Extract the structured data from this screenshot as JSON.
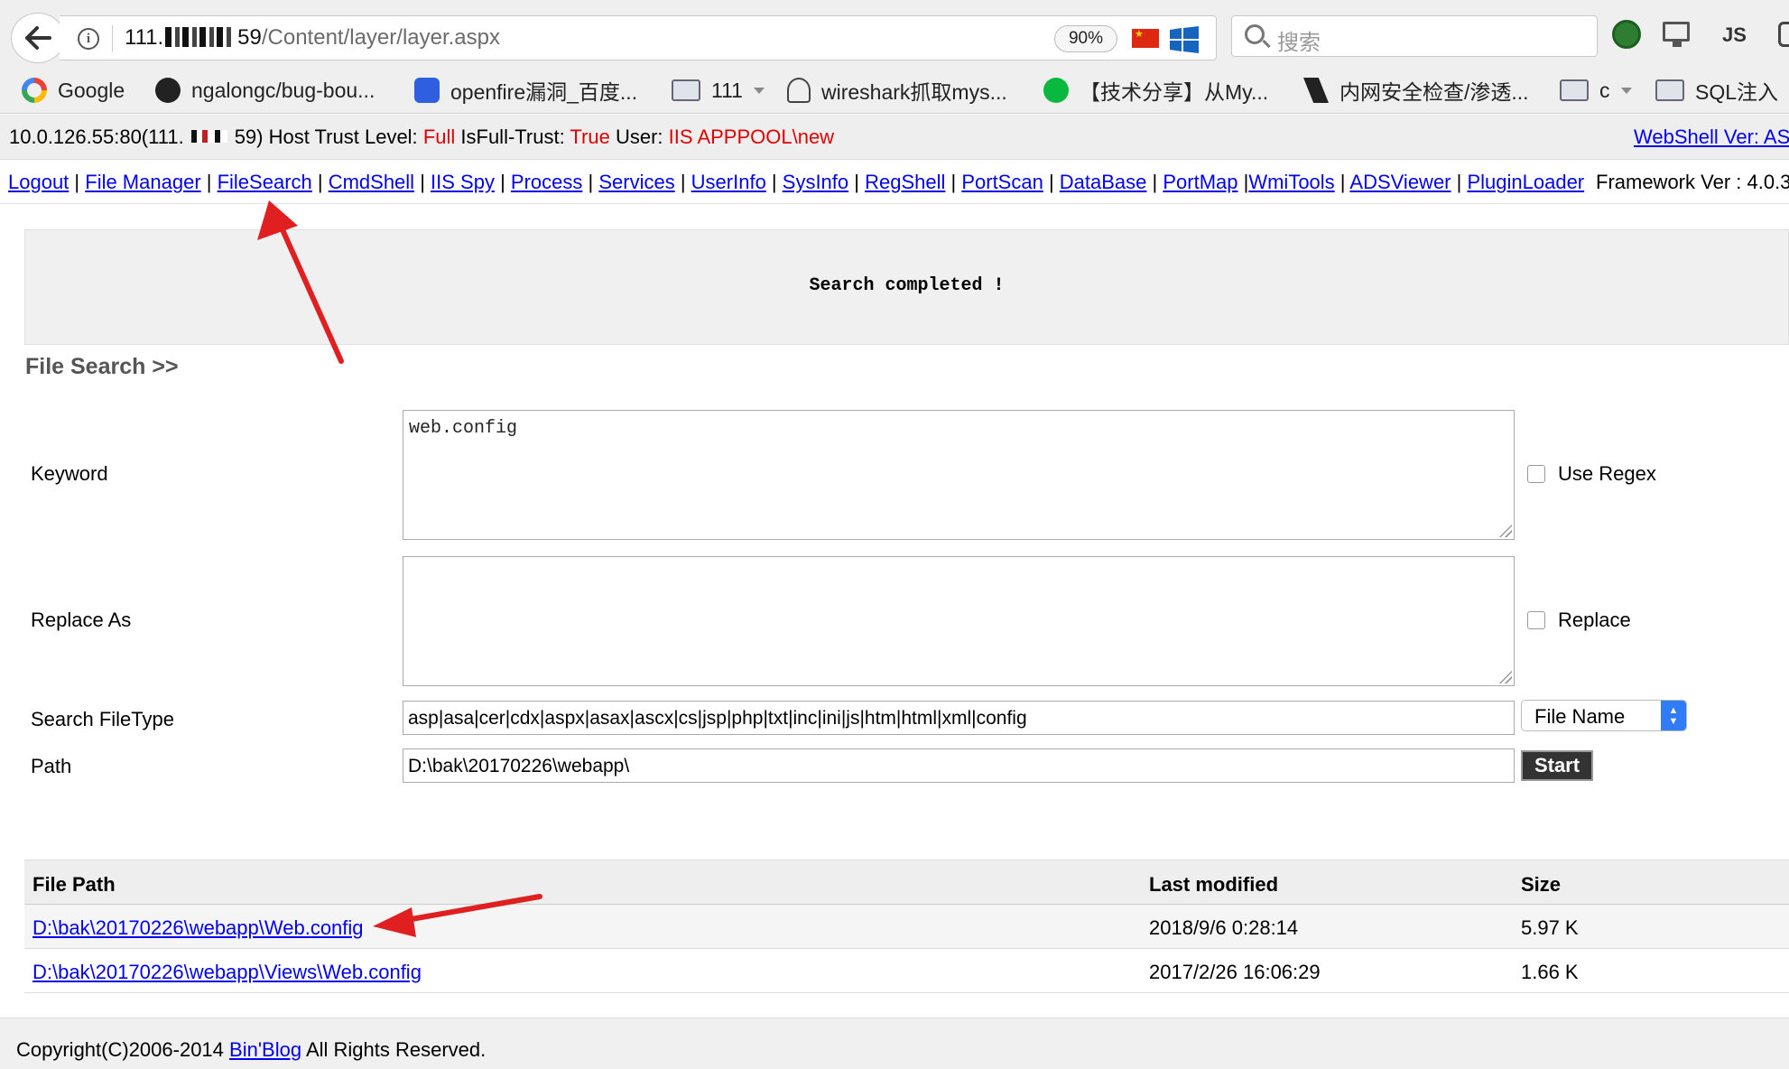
{
  "browser": {
    "url_prefix": "111.",
    "url_host_tail": "59",
    "url_path": "/Content/layer/layer.aspx",
    "zoom": "90%",
    "search_placeholder": "搜索",
    "ext_js_label": "JS",
    "bookmarks": [
      {
        "label": "Google",
        "icon": "google-icon"
      },
      {
        "label": "ngalongc/bug-bou...",
        "icon": "github-icon"
      },
      {
        "label": "openfire漏洞_百度...",
        "icon": "baidu-icon"
      },
      {
        "label": "111",
        "icon": "folder-icon"
      },
      {
        "label": "wireshark抓取mys...",
        "icon": "wireshark-icon"
      },
      {
        "label": "【技术分享】从My...",
        "icon": "wechat-icon"
      },
      {
        "label": "内网安全检查/渗透...",
        "icon": "slash-icon"
      },
      {
        "label": "c",
        "icon": "folder-icon"
      },
      {
        "label": "SQL注入",
        "icon": "folder-icon"
      }
    ]
  },
  "info": {
    "host_prefix": "10.0.126.55:80(111.",
    "host_suffix": "59)",
    "trust_label": "Host Trust Level:",
    "trust_value": "Full",
    "full_trust_label": "IsFull-Trust:",
    "full_trust_value": "True",
    "user_label": "User:",
    "user_value": "IIS APPPOOL\\new",
    "version_link": "WebShell Ver: AS"
  },
  "menu": {
    "items": [
      "Logout",
      "File Manager",
      "FileSearch",
      "CmdShell",
      "IIS Spy",
      "Process",
      "Services",
      "UserInfo",
      "SysInfo",
      "RegShell",
      "PortScan",
      "DataBase",
      "PortMap",
      "WmiTools",
      "ADSViewer",
      "PluginLoader"
    ],
    "framework": "Framework Ver : 4.0.3"
  },
  "status": {
    "message": "Search completed !"
  },
  "search_form": {
    "title": "File Search >>",
    "keyword_label": "Keyword",
    "keyword_value": "web.config",
    "use_regex_label": "Use Regex",
    "replace_label": "Replace As",
    "replace_value": "",
    "replace_check_label": "Replace",
    "filetype_label": "Search FileType",
    "filetype_value": "asp|asa|cer|cdx|aspx|asax|ascx|cs|jsp|php|txt|inc|ini|js|htm|html|xml|config",
    "match_option": "File Name",
    "path_label": "Path",
    "path_value": "D:\\bak\\20170226\\webapp\\",
    "start_label": "Start"
  },
  "results": {
    "headers": [
      "File Path",
      "Last modified",
      "Size"
    ],
    "rows": [
      {
        "path": "D:\\bak\\20170226\\webapp\\Web.config",
        "modified": "2018/9/6 0:28:14",
        "size": "5.97 K"
      },
      {
        "path": "D:\\bak\\20170226\\webapp\\Views\\Web.config",
        "modified": "2017/2/26 16:06:29",
        "size": "1.66 K"
      }
    ]
  },
  "footer": {
    "prefix": "Copyright(C)2006-2014",
    "link": "Bin'Blog",
    "suffix": "All Rights Reserved."
  },
  "annotation_color": "#e02020"
}
